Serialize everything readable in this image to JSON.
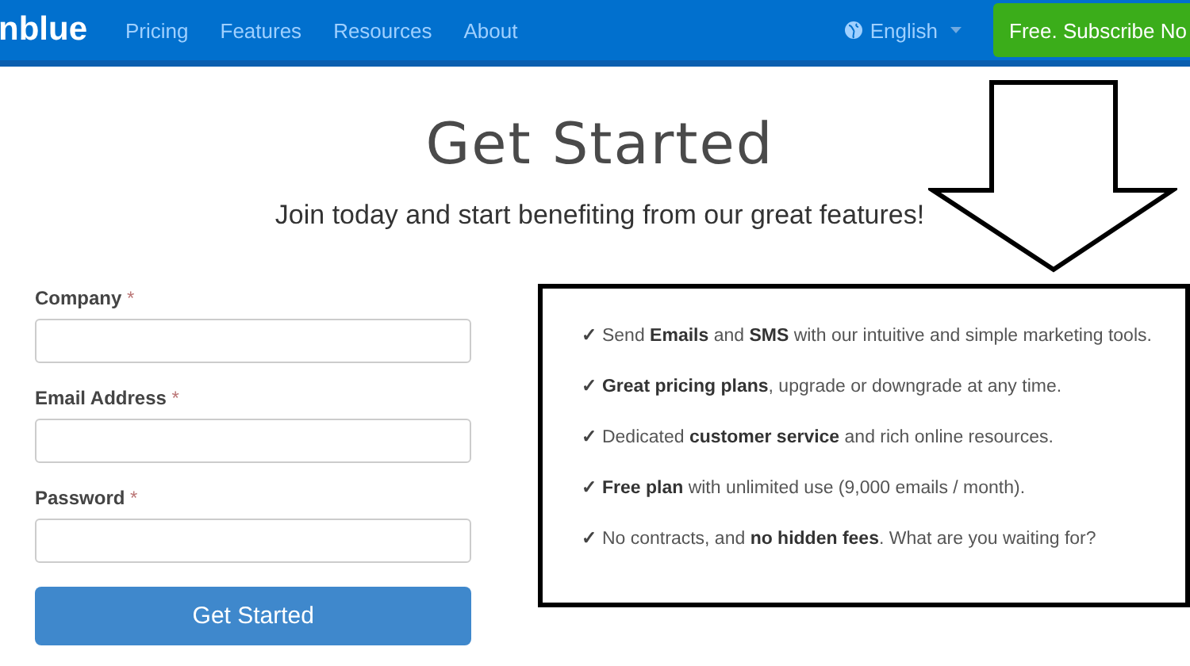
{
  "navbar": {
    "logo": "nblue",
    "links": [
      {
        "label": "Pricing"
      },
      {
        "label": "Features"
      },
      {
        "label": "Resources"
      },
      {
        "label": "About"
      }
    ],
    "language": "English",
    "cta": "Free. Subscribe No"
  },
  "hero": {
    "title": "Get Started",
    "subtitle": "Join today and start benefiting from our great features!"
  },
  "form": {
    "fields": [
      {
        "label": "Company",
        "required_mark": "*"
      },
      {
        "label": "Email Address",
        "required_mark": "*"
      },
      {
        "label": "Password",
        "required_mark": "*"
      }
    ],
    "submit": "Get Started"
  },
  "features": [
    {
      "mark": "✓",
      "text": "Send **Emails** and **SMS** with our intuitive and simple marketing tools."
    },
    {
      "mark": "✓",
      "text": "**Great pricing plans**, upgrade or downgrade at any time."
    },
    {
      "mark": "✓",
      "text": "Dedicated **customer service** and rich online resources."
    },
    {
      "mark": "✓",
      "text": "**Free plan** with unlimited use (9,000 emails / month)."
    },
    {
      "mark": "✓",
      "text": "No contracts, and **no hidden fees**. What are you waiting for?"
    }
  ]
}
